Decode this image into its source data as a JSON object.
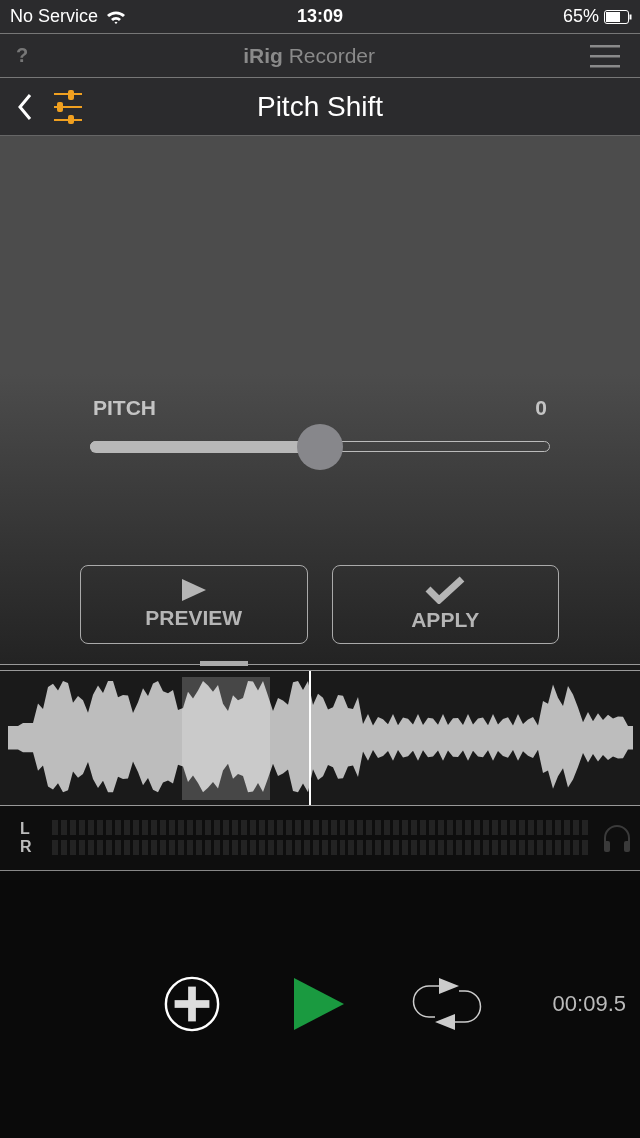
{
  "status_bar": {
    "carrier": "No Service",
    "time": "13:09",
    "battery": "65%"
  },
  "app_bar": {
    "help": "?",
    "title": "**iRig** Recorder"
  },
  "nav_bar": {
    "title": "Pitch Shift"
  },
  "pitch": {
    "label": "PITCH",
    "value": "0",
    "level": 0.5
  },
  "buttons": [
    {
      "kind": "play",
      "label": "PREVIEW"
    },
    {
      "kind": "check",
      "label": "APPLY"
    }
  ],
  "meter": {
    "left": "L",
    "right": "R"
  },
  "transport": {
    "time": "00:09.5"
  }
}
